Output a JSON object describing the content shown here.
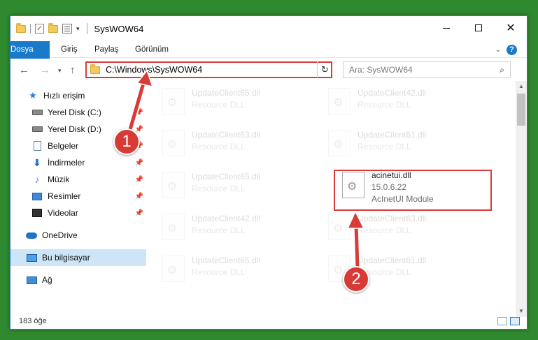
{
  "window": {
    "title": "SysWOW64"
  },
  "ribbon": {
    "tabs": [
      "Dosya",
      "Giriş",
      "Paylaş",
      "Görünüm"
    ]
  },
  "address": {
    "path": "C:\\Windows\\SysWOW64"
  },
  "search": {
    "placeholder": "Ara: SysWOW64"
  },
  "sidebar": {
    "items": [
      {
        "label": "Hızlı erişim",
        "icon": "star-icon"
      },
      {
        "label": "Yerel Disk (C:)",
        "icon": "drive-icon"
      },
      {
        "label": "Yerel Disk (D:)",
        "icon": "drive-icon"
      },
      {
        "label": "Belgeler",
        "icon": "documents-icon"
      },
      {
        "label": "İndirmeler",
        "icon": "downloads-icon"
      },
      {
        "label": "Müzik",
        "icon": "music-icon"
      },
      {
        "label": "Resimler",
        "icon": "pictures-icon"
      },
      {
        "label": "Videolar",
        "icon": "videos-icon"
      },
      {
        "label": "OneDrive",
        "icon": "onedrive-icon"
      },
      {
        "label": "Bu bilgisayar",
        "icon": "this-pc-icon"
      },
      {
        "label": "Ağ",
        "icon": "network-icon"
      }
    ]
  },
  "files": [
    {
      "name": "UpdateClient65.dll",
      "desc": "Resource DLL"
    },
    {
      "name": "UpdateClient42.dll",
      "desc": "Resource DLL"
    },
    {
      "name": "UpdateClient63.dll",
      "desc": "Resource DLL"
    },
    {
      "name": "UpdateClient61.dll",
      "desc": "Resource DLL"
    },
    {
      "name": "UpdateClient65.dll",
      "desc": "Resource DLL"
    },
    {
      "name": "acinetui.dll",
      "desc": "15.0.6.22",
      "desc2": "AcInetUI Module"
    },
    {
      "name": "UpdateClient42.dll",
      "desc": "Resource DLL"
    },
    {
      "name": "UpdateClient63.dll",
      "desc": "Resource DLL"
    },
    {
      "name": "UpdateClient65.dll",
      "desc": "Resource DLL"
    },
    {
      "name": "UpdateClient61.dll",
      "desc": "Resource DLL"
    }
  ],
  "status": {
    "count": "183 öğe"
  },
  "callouts": [
    "1",
    "2"
  ],
  "colors": {
    "accent": "#1979ca",
    "highlight": "#d93a3a",
    "background": "#2f8a2f"
  }
}
